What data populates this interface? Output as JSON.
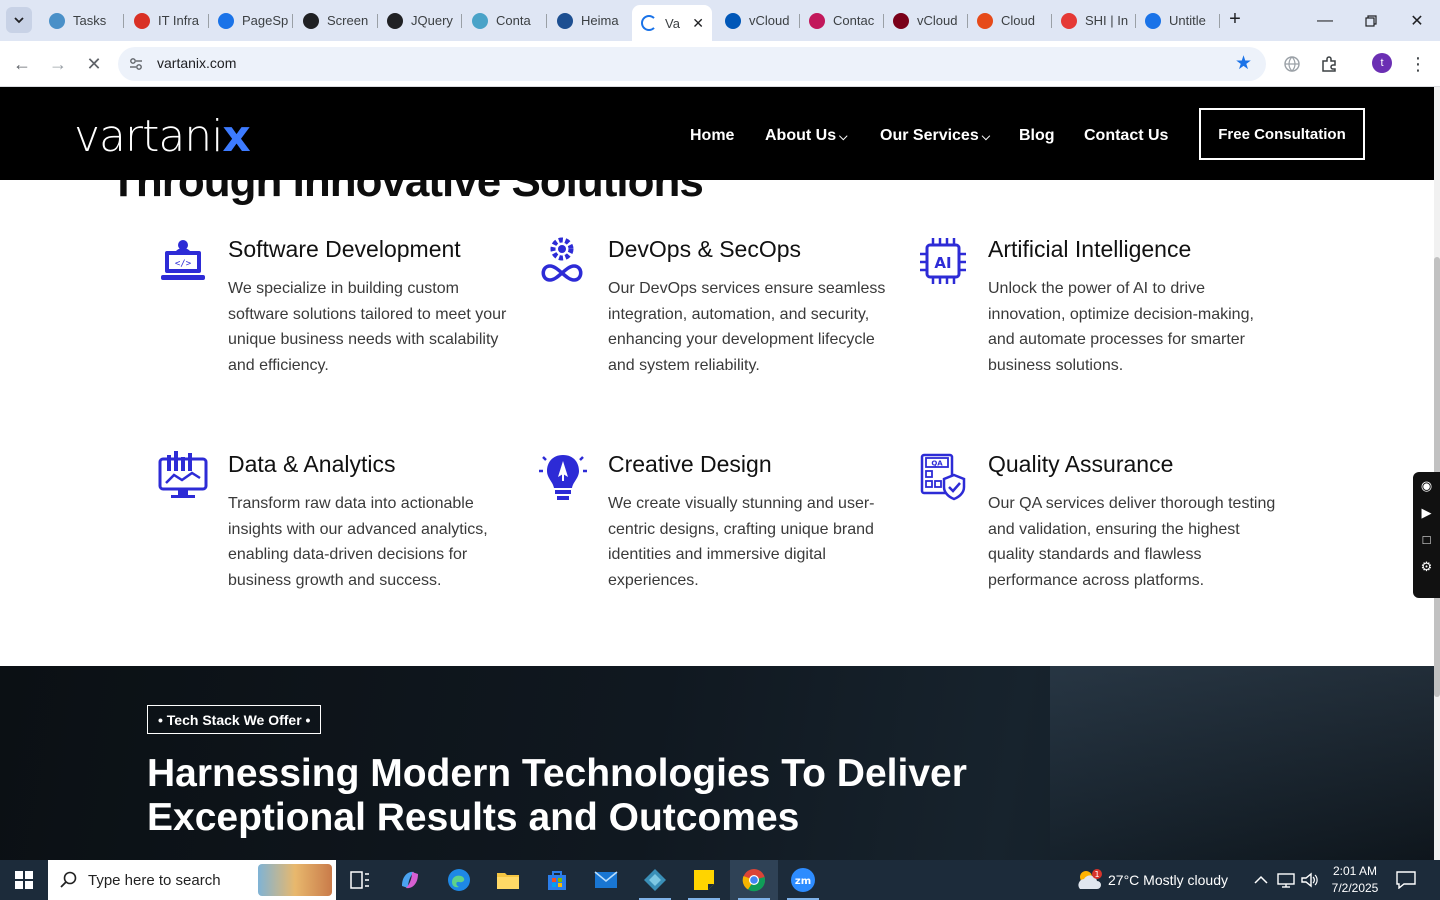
{
  "browser": {
    "tabs": [
      {
        "label": "Tasks",
        "color": "#4a90c8"
      },
      {
        "label": "IT Infra",
        "color": "#d93025"
      },
      {
        "label": "PageSp",
        "color": "#1a73e8"
      },
      {
        "label": "Screen",
        "color": "#202124"
      },
      {
        "label": "JQuery",
        "color": "#202124"
      },
      {
        "label": "Conta",
        "color": "#4aa3c8"
      },
      {
        "label": "Heima",
        "color": "#1d4f91"
      },
      {
        "label": "Va",
        "color": "#1a73e8"
      },
      {
        "label": "vCloud",
        "color": "#0057b8"
      },
      {
        "label": "Contac",
        "color": "#c2185b"
      },
      {
        "label": "vCloud",
        "color": "#7a0019"
      },
      {
        "label": "Cloud",
        "color": "#e64a19"
      },
      {
        "label": "SHI | In",
        "color": "#e53935"
      },
      {
        "label": "Untitle",
        "color": "#1a73e8"
      }
    ],
    "url": "vartanix.com",
    "profile_initial": "t"
  },
  "site": {
    "logo_text": "vartani",
    "logo_accent": "x",
    "nav": {
      "home": "Home",
      "about": "About Us",
      "services": "Our Services",
      "blog": "Blog",
      "contact": "Contact Us",
      "cta": "Free Consultation"
    },
    "partial_heading": "Through Innovative Solutions",
    "services": [
      {
        "title": "Software Development",
        "desc": "We specialize in building custom software solutions tailored to meet your unique business needs with scalability and efficiency.",
        "icon": "laptop-code-icon"
      },
      {
        "title": "DevOps & SecOps",
        "desc": "Our DevOps services ensure seamless integration, automation, and security, enhancing your development lifecycle and system reliability.",
        "icon": "devops-gear-icon"
      },
      {
        "title": "Artificial Intelligence",
        "desc": "Unlock the power of AI to drive innovation, optimize decision-making, and automate processes for smarter business solutions.",
        "icon": "ai-chip-icon"
      },
      {
        "title": "Data & Analytics",
        "desc": "Transform raw data into actionable insights with our advanced analytics, enabling data-driven decisions for business growth and success.",
        "icon": "analytics-monitor-icon"
      },
      {
        "title": "Creative Design",
        "desc": "We create visually stunning and user-centric designs, crafting unique brand identities and immersive digital experiences.",
        "icon": "lightbulb-pen-icon"
      },
      {
        "title": "Quality Assurance",
        "desc": "Our QA services deliver thorough testing and validation, ensuring the highest quality standards and flawless performance across platforms.",
        "icon": "qa-checklist-icon"
      }
    ],
    "tech_badge": "• Tech Stack We Offer •",
    "tech_title": "Harnessing Modern Technologies To Deliver Exceptional Results and Outcomes",
    "accent_color": "#2d2bd6"
  },
  "taskbar": {
    "search_placeholder": "Type here to search",
    "weather_badge": "1",
    "weather": "27°C  Mostly cloudy",
    "time": "2:01 AM",
    "date": "7/2/2025"
  }
}
